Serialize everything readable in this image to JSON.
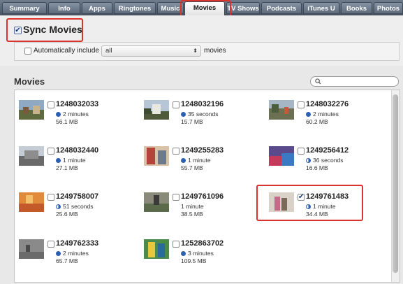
{
  "tabs": [
    {
      "label": "Summary",
      "active": false
    },
    {
      "label": "Info",
      "active": false
    },
    {
      "label": "Apps",
      "active": false
    },
    {
      "label": "Ringtones",
      "active": false
    },
    {
      "label": "Music",
      "active": false
    },
    {
      "label": "Movies",
      "active": true
    },
    {
      "label": "TV Shows",
      "active": false
    },
    {
      "label": "Podcasts",
      "active": false
    },
    {
      "label": "iTunes U",
      "active": false
    },
    {
      "label": "Books",
      "active": false
    },
    {
      "label": "Photos",
      "active": false
    }
  ],
  "sync": {
    "label": "Sync Movies",
    "checked": true
  },
  "auto_include": {
    "label": "Automatically include",
    "selected": "all",
    "suffix": "movies",
    "checked": false
  },
  "movies_section": {
    "title": "Movies",
    "search_placeholder": ""
  },
  "movies": [
    {
      "title": "1248032033",
      "duration": "2 minutes",
      "size": "56.1 MB",
      "checked": false,
      "dot": "full"
    },
    {
      "title": "1248032196",
      "duration": "35 seconds",
      "size": "15.7 MB",
      "checked": false,
      "dot": "full"
    },
    {
      "title": "1248032276",
      "duration": "2 minutes",
      "size": "60.2 MB",
      "checked": false,
      "dot": "full"
    },
    {
      "title": "1248032440",
      "duration": "1 minute",
      "size": "27.1 MB",
      "checked": false,
      "dot": "full"
    },
    {
      "title": "1249255283",
      "duration": "1 minute",
      "size": "55.7 MB",
      "checked": false,
      "dot": "full"
    },
    {
      "title": "1249256412",
      "duration": "36 seconds",
      "size": "16.6 MB",
      "checked": false,
      "dot": "half"
    },
    {
      "title": "1249758007",
      "duration": "51 seconds",
      "size": "25.6 MB",
      "checked": false,
      "dot": "half"
    },
    {
      "title": "1249761096",
      "duration": "1 minute",
      "size": "38.5 MB",
      "checked": false,
      "dot": "none"
    },
    {
      "title": "1249761483",
      "duration": "1 minute",
      "size": "34.4 MB",
      "checked": true,
      "dot": "half"
    },
    {
      "title": "1249762333",
      "duration": "2 minutes",
      "size": "65.7 MB",
      "checked": false,
      "dot": "full"
    },
    {
      "title": "1252863702",
      "duration": "3 minutes",
      "size": "109.5 MB",
      "checked": false,
      "dot": "full"
    }
  ],
  "colors": {
    "highlight": "#d9342b",
    "tabbar": "#5e6b7c",
    "progress_blue": "#2d5fb3"
  }
}
